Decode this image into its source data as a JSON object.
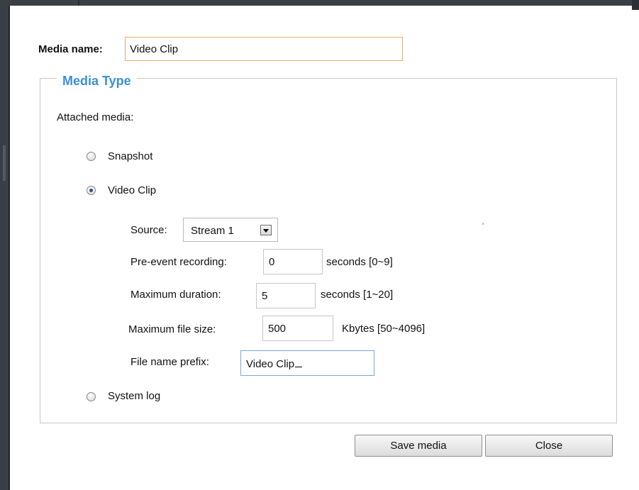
{
  "media_name": {
    "label": "Media name:",
    "value": "Video Clip"
  },
  "media_type": {
    "legend": "Media Type",
    "attached_label": "Attached media:",
    "options": [
      {
        "label": "Snapshot",
        "checked": false
      },
      {
        "label": "Video Clip",
        "checked": true
      },
      {
        "label": "System log",
        "checked": false
      }
    ]
  },
  "video_clip": {
    "source": {
      "label": "Source:",
      "value": "Stream 1"
    },
    "pre_event": {
      "label": "Pre-event recording:",
      "value": "0",
      "hint": "seconds [0~9]"
    },
    "max_duration": {
      "label": "Maximum duration:",
      "value": "5",
      "hint": "seconds [1~20]"
    },
    "max_file_size": {
      "label": "Maximum file size:",
      "value": "500",
      "hint": "Kbytes [50~4096]"
    },
    "prefix": {
      "label": "File name prefix:",
      "value": "Video Clip"
    }
  },
  "buttons": {
    "save": "Save media",
    "close": "Close"
  },
  "colors": {
    "legend": "#3d8fd6",
    "focus_border": "#f0a860"
  }
}
